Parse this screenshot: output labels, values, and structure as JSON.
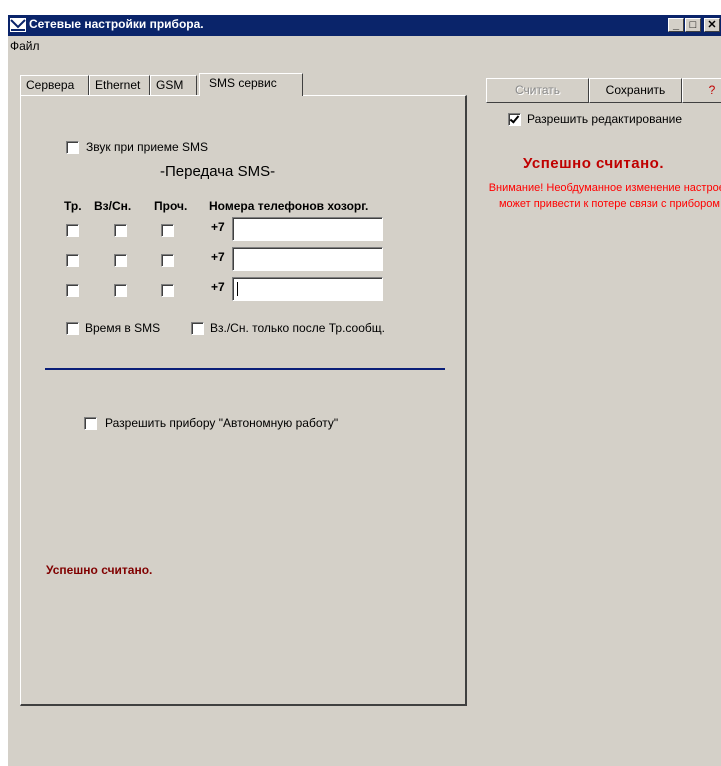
{
  "window": {
    "title": "Сетевые настройки прибора.",
    "controls": {
      "minimize": "_",
      "maximize": "□",
      "close": "✕"
    }
  },
  "menu": {
    "file": "Файл"
  },
  "tabs": [
    {
      "label": "Сервера",
      "active": false
    },
    {
      "label": "Ethernet",
      "active": false
    },
    {
      "label": "GSM",
      "active": false
    },
    {
      "label": "SMS сервис",
      "active": true
    }
  ],
  "sms": {
    "sound_on_receive": {
      "label": "Звук при приеме SMS",
      "checked": false
    },
    "section_title": "-Передача SMS-",
    "columns": {
      "tr": "Тр.",
      "vz": "Вз/Сн.",
      "proch": "Проч.",
      "phones": "Номера телефонов хозорг."
    },
    "rows": [
      {
        "prefix": "+7",
        "value": "",
        "tr": false,
        "vz": false,
        "proch": false
      },
      {
        "prefix": "+7",
        "value": "",
        "tr": false,
        "vz": false,
        "proch": false
      },
      {
        "prefix": "+7",
        "value": "",
        "tr": false,
        "vz": false,
        "proch": false
      }
    ],
    "time_in_sms": {
      "label": "Время в SMS",
      "checked": false
    },
    "vz_after_tr": {
      "label": "Вз./Сн. только после Тр.сообщ.",
      "checked": false
    },
    "autonomous": {
      "label": "Разрешить прибору \"Автономную работу\"",
      "checked": false
    },
    "status": "Успешно считано."
  },
  "right": {
    "read_button": "Считать",
    "save_button": "Сохранить",
    "help_button": "?",
    "allow_edit": {
      "label": "Разрешить редактирование",
      "checked": true
    },
    "status": "Успешно считано.",
    "warning": "Внимание! Необдуманное изменение настроек-может привести к потере связи с прибором."
  },
  "colors": {
    "title_bar": "#0a246a",
    "status_dark_red": "#800000",
    "status_red": "#c00000",
    "warning_red": "#ff0000",
    "divider": "#0a1e78"
  }
}
